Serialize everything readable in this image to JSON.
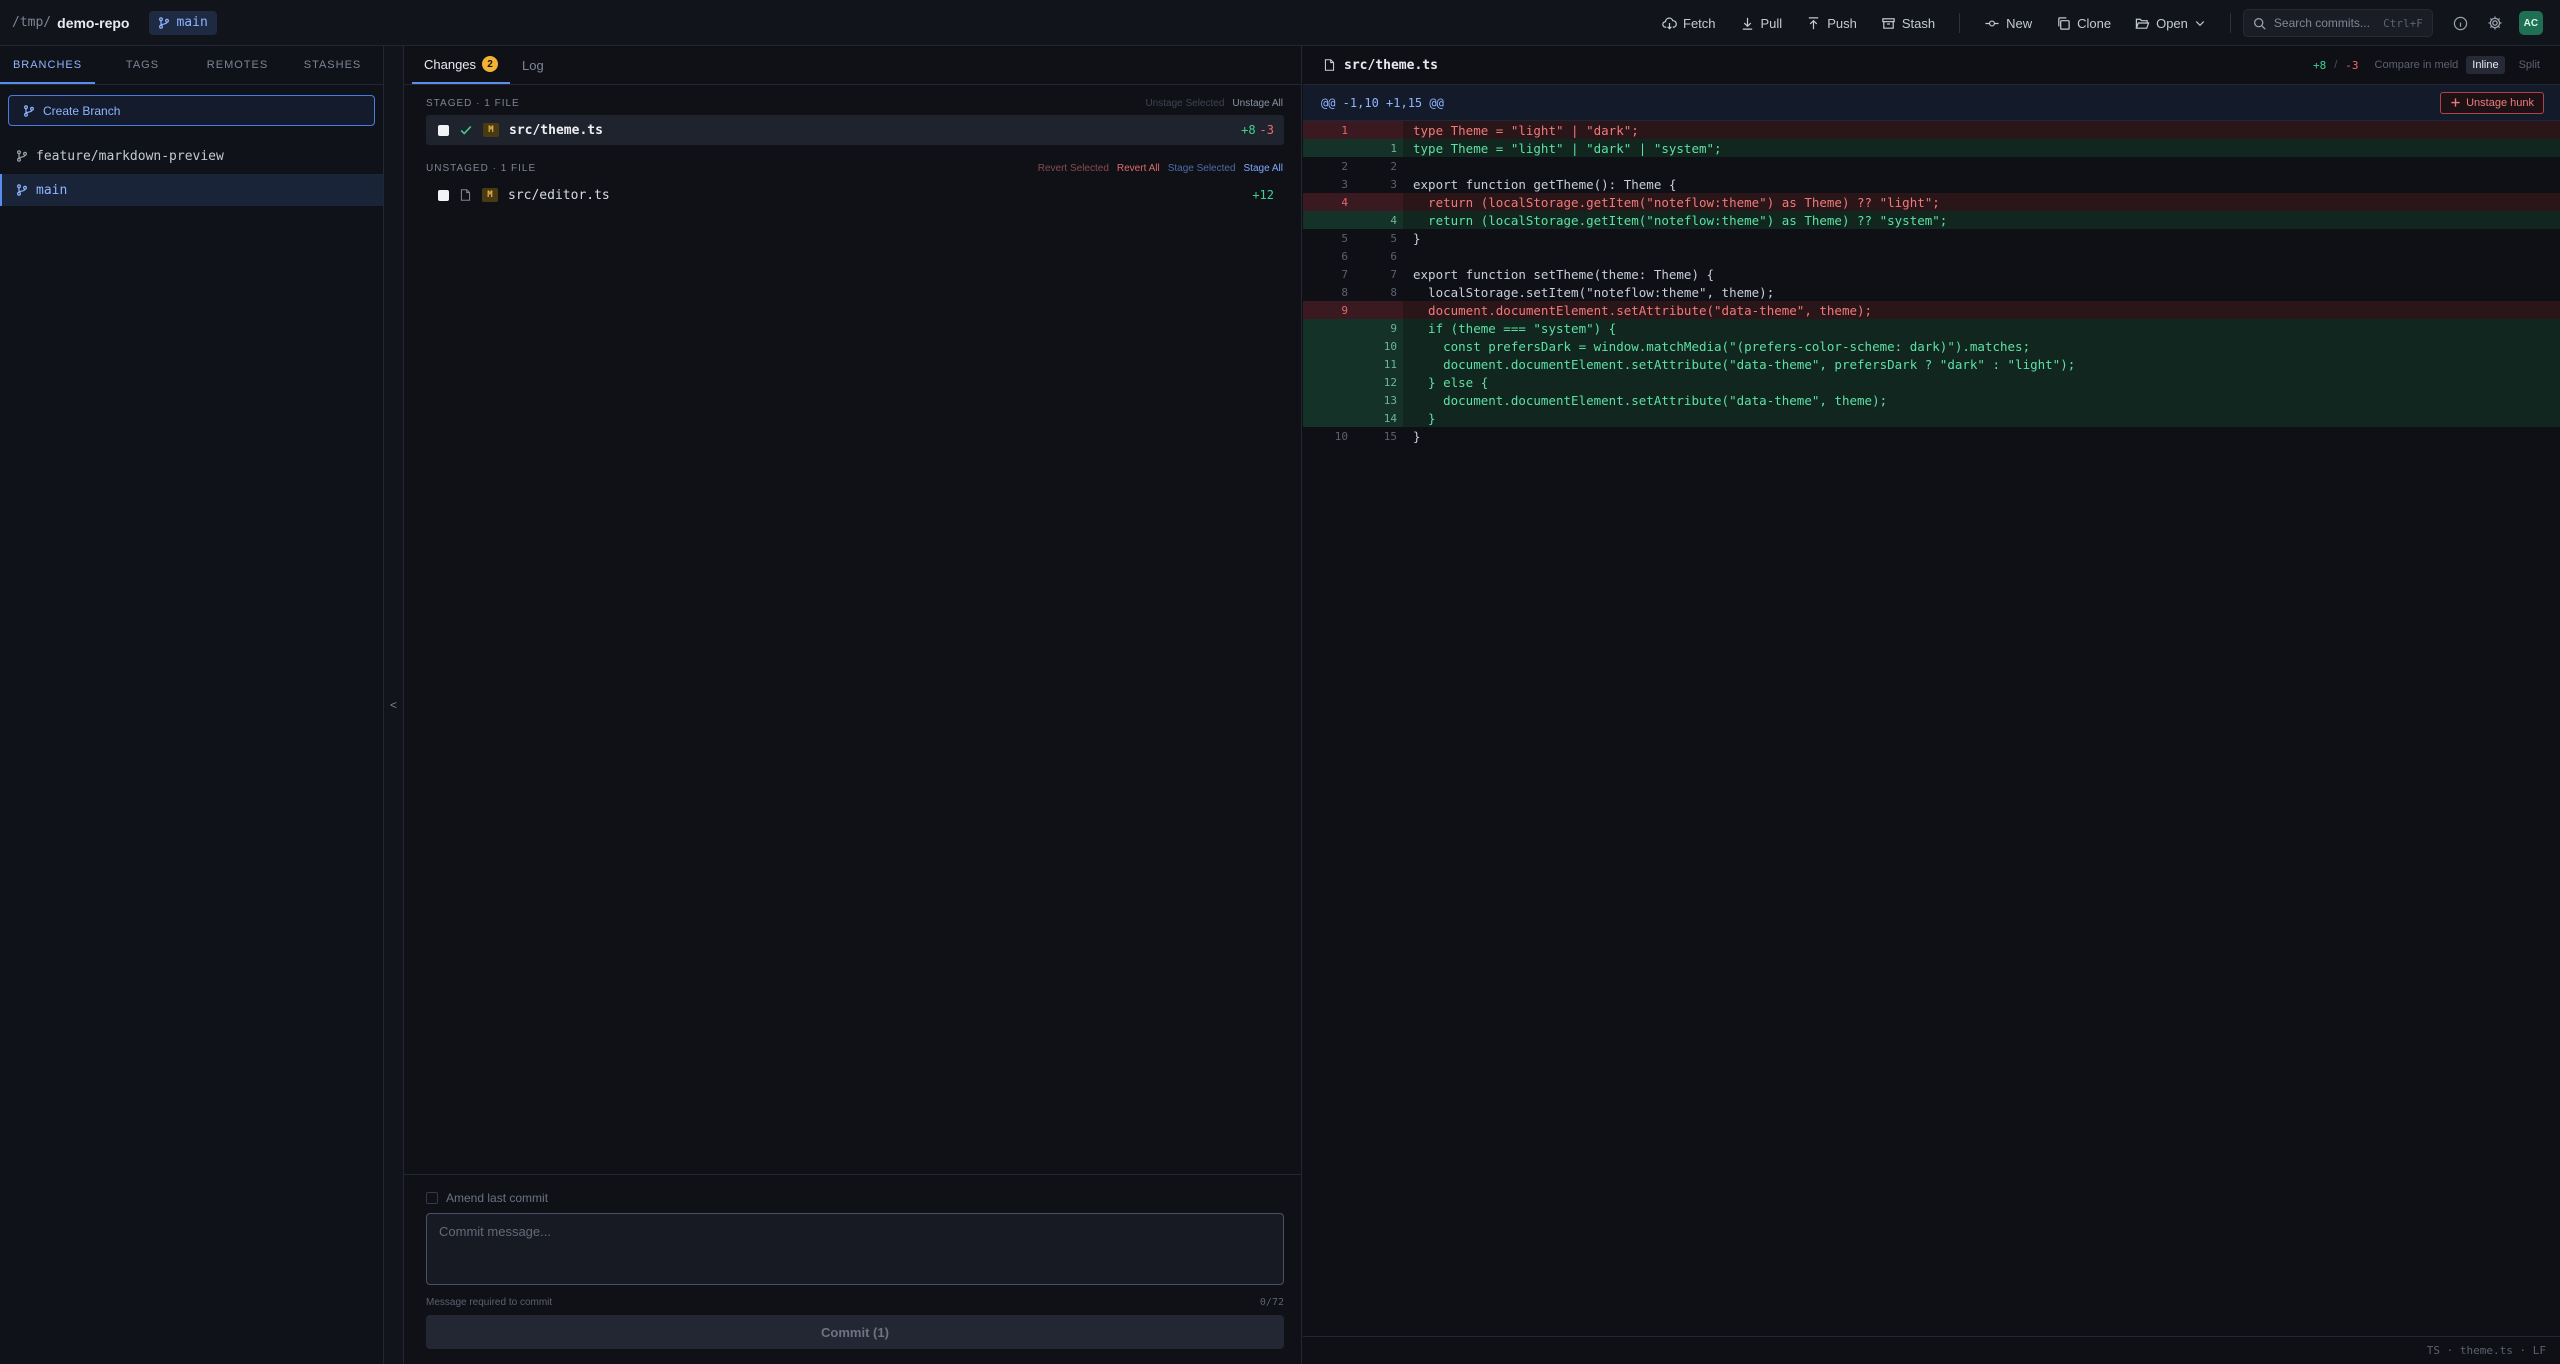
{
  "topbar": {
    "repo_path": "/tmp/",
    "repo_name": "demo-repo",
    "branch": "main",
    "actions": {
      "fetch": "Fetch",
      "pull": "Pull",
      "push": "Push",
      "stash": "Stash",
      "new": "New",
      "clone": "Clone",
      "open": "Open"
    },
    "search_placeholder": "Search commits...",
    "search_shortcut": "Ctrl+F",
    "avatar": "AC"
  },
  "sidebar": {
    "tabs": [
      "BRANCHES",
      "TAGS",
      "REMOTES",
      "STASHES"
    ],
    "create_branch": "Create Branch",
    "branches": [
      "feature/markdown-preview",
      "main"
    ]
  },
  "collapse_glyph": "<",
  "changes": {
    "tabs": {
      "changes": "Changes",
      "changes_count": "2",
      "log": "Log"
    },
    "staged": {
      "title": "STAGED · 1 FILE",
      "unstage_selected": "Unstage Selected",
      "unstage_all": "Unstage All",
      "files": [
        {
          "status": "M",
          "name": "src/theme.ts",
          "added": "+8",
          "removed": "-3"
        }
      ]
    },
    "unstaged": {
      "title": "UNSTAGED · 1 FILE",
      "revert_selected": "Revert Selected",
      "revert_all": "Revert All",
      "stage_selected": "Stage Selected",
      "stage_all": "Stage All",
      "files": [
        {
          "status": "M",
          "name": "src/editor.ts",
          "added": "+12"
        }
      ]
    }
  },
  "commit": {
    "amend_label": "Amend last commit",
    "placeholder": "Commit message...",
    "hint": "Message required to commit",
    "char_count": "0/72",
    "button": "Commit (1)"
  },
  "diff": {
    "file": "src/theme.ts",
    "added": "+8",
    "slash": "/",
    "removed": "-3",
    "compare_meld": "Compare in meld",
    "mode_inline": "Inline",
    "mode_split": "Split",
    "hunk_header": "@@ -1,10 +1,15 @@",
    "unstage_hunk": "Unstage hunk",
    "lines": [
      {
        "type": "del",
        "old": "1",
        "new": "",
        "text": "type Theme = \"light\" | \"dark\";"
      },
      {
        "type": "add",
        "old": "",
        "new": "1",
        "text": "type Theme = \"light\" | \"dark\" | \"system\";"
      },
      {
        "type": "ctx",
        "old": "2",
        "new": "2",
        "text": ""
      },
      {
        "type": "ctx",
        "old": "3",
        "new": "3",
        "text": "export function getTheme(): Theme {"
      },
      {
        "type": "del",
        "old": "4",
        "new": "",
        "text": "  return (localStorage.getItem(\"noteflow:theme\") as Theme) ?? \"light\";"
      },
      {
        "type": "add",
        "old": "",
        "new": "4",
        "text": "  return (localStorage.getItem(\"noteflow:theme\") as Theme) ?? \"system\";"
      },
      {
        "type": "ctx",
        "old": "5",
        "new": "5",
        "text": "}"
      },
      {
        "type": "ctx",
        "old": "6",
        "new": "6",
        "text": ""
      },
      {
        "type": "ctx",
        "old": "7",
        "new": "7",
        "text": "export function setTheme(theme: Theme) {"
      },
      {
        "type": "ctx",
        "old": "8",
        "new": "8",
        "text": "  localStorage.setItem(\"noteflow:theme\", theme);"
      },
      {
        "type": "del",
        "old": "9",
        "new": "",
        "text": "  document.documentElement.setAttribute(\"data-theme\", theme);"
      },
      {
        "type": "add",
        "old": "",
        "new": "9",
        "text": "  if (theme === \"system\") {"
      },
      {
        "type": "add",
        "old": "",
        "new": "10",
        "text": "    const prefersDark = window.matchMedia(\"(prefers-color-scheme: dark)\").matches;"
      },
      {
        "type": "add",
        "old": "",
        "new": "11",
        "text": "    document.documentElement.setAttribute(\"data-theme\", prefersDark ? \"dark\" : \"light\");"
      },
      {
        "type": "add",
        "old": "",
        "new": "12",
        "text": "  } else {"
      },
      {
        "type": "add",
        "old": "",
        "new": "13",
        "text": "    document.documentElement.setAttribute(\"data-theme\", theme);"
      },
      {
        "type": "add",
        "old": "",
        "new": "14",
        "text": "  }"
      },
      {
        "type": "ctx",
        "old": "10",
        "new": "15",
        "text": "}"
      }
    ]
  },
  "statusbar": "TS · theme.ts · LF"
}
